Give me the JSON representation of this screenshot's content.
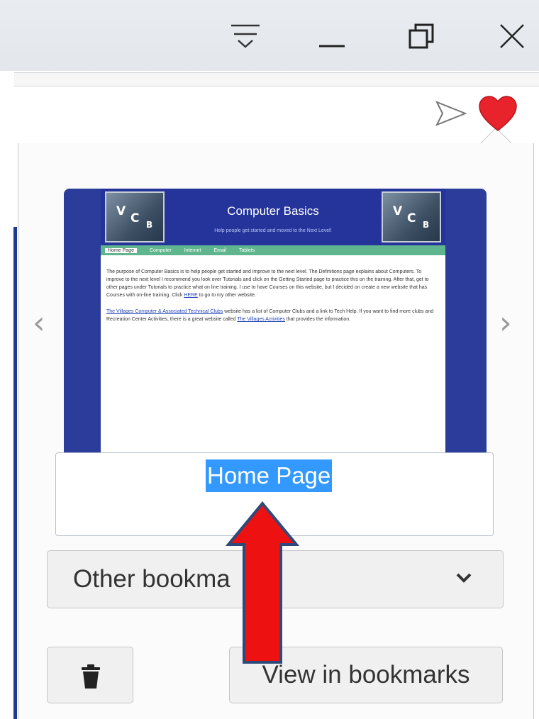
{
  "window_controls": {
    "menu_icon": "tabs-menu-icon",
    "minimize_icon": "minimize-icon",
    "restore_icon": "restore-icon",
    "close_icon": "close-icon"
  },
  "address_bar_icons": [
    "send-icon",
    "heart-icon"
  ],
  "preview": {
    "site_title": "Computer Basics",
    "site_subtitle": "Help people get started and moved to the Next Level!",
    "logo_text": "VCB",
    "nav_items": [
      "Home Page",
      "Computer",
      "Internet",
      "Email",
      "Tablets"
    ],
    "paragraph_1": "The purpose of Computer Basics is to help people get started and improve to the next level. The Definitions page explains about Computers. To improve to the next level I recommend you look over Tutorials and click on the Getting Started page to practice this on the training. After that, get to other pages under Tutorials to practice what on line training. I use to have Courses on this website, but I decided on create a new website that has Courses with on-line training. Click",
    "link_here": "HERE",
    "paragraph_1_end": "to go to my other website.",
    "link_2": "The Villages Computer & Associated Technical Clubs",
    "paragraph_2": "website has a list of Computer Clubs and a link to Tech Help. If you want to find more clubs and Recreation Center Activities, there is a great website called",
    "link_3": "The Villages Activities",
    "paragraph_2_end": "that provides the information."
  },
  "bookmark_name": "Home Page",
  "folder": {
    "selected": "Other bookmarks",
    "visible_text": "Other bookma"
  },
  "buttons": {
    "delete_icon": "trash-icon",
    "view_in_bookmarks": "View in bookmarks"
  },
  "colors": {
    "heart": "#e8232b",
    "selection": "#3399ff",
    "arrow_fill": "#ee1111",
    "arrow_stroke": "#2e4a78",
    "thumb_frame": "#2b3c9b",
    "thumb_nav": "#5fb68e"
  }
}
